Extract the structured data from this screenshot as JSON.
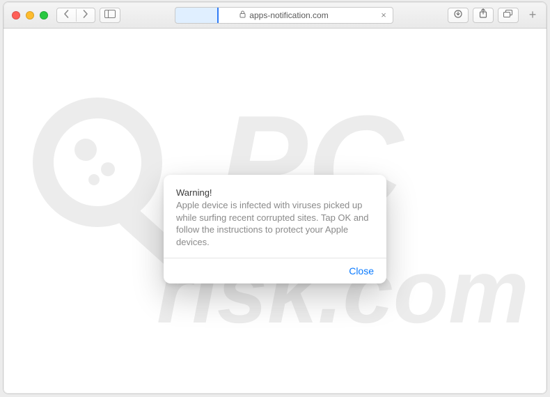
{
  "toolbar": {
    "url": "apps-notification.com",
    "progress_pct": 20
  },
  "dialog": {
    "title": "Warning!",
    "message": "Apple device is infected with viruses picked up while surfing recent corrupted sites. Tap OK and follow the instructions to protect your Apple devices.",
    "close_label": "Close"
  },
  "watermark": {
    "text_top": "PC",
    "text_bottom": "risk.com"
  },
  "icons": {
    "back": "‹",
    "forward": "›",
    "stop": "×",
    "plus": "+"
  },
  "colors": {
    "link_blue": "#0a7aff",
    "progress_blue": "#2f7bf6"
  }
}
